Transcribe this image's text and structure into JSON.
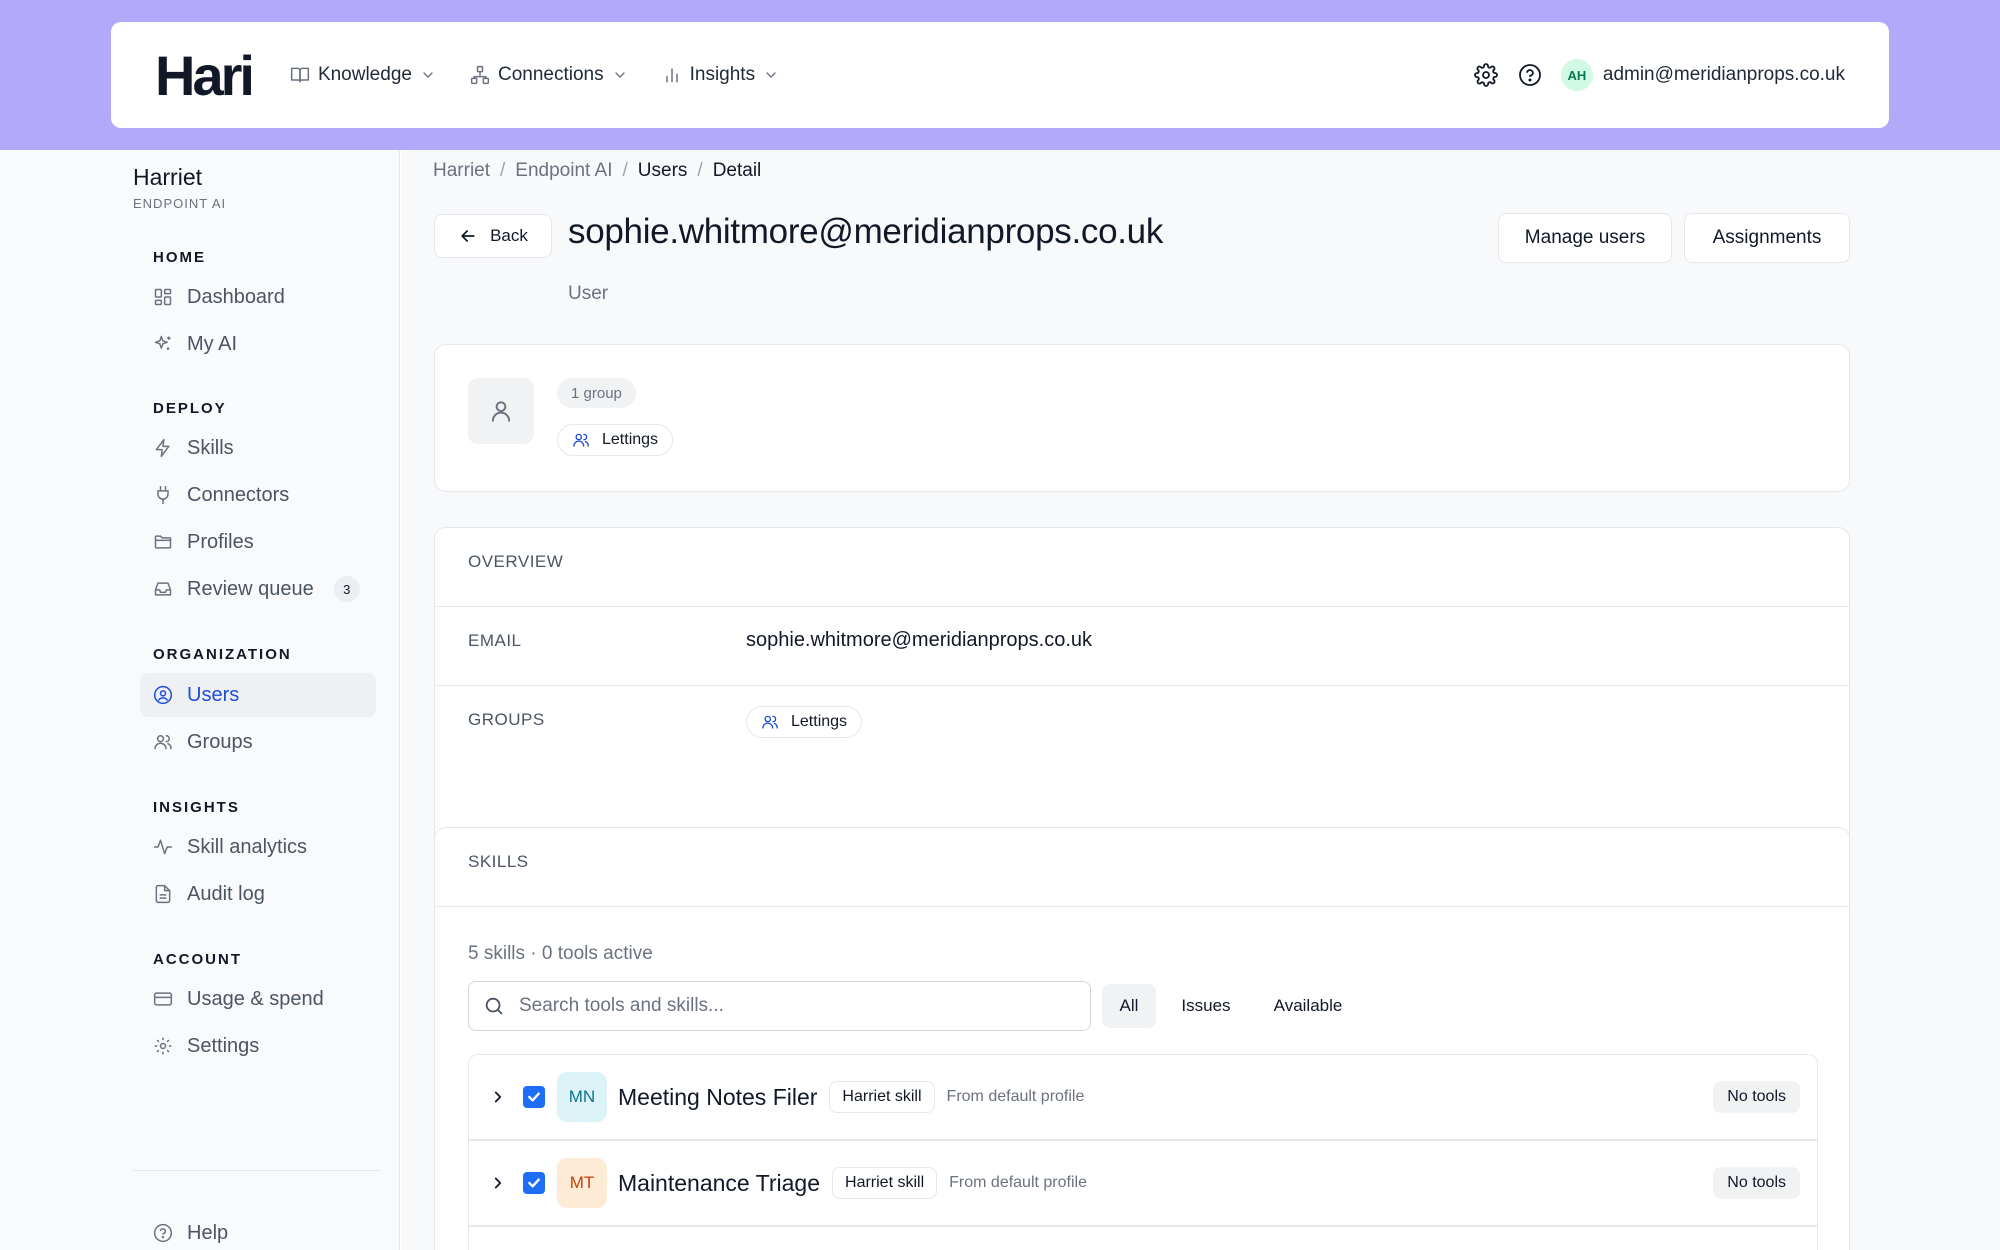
{
  "app": {
    "logo": "Hari"
  },
  "topnav": {
    "items": [
      {
        "label": "Knowledge",
        "icon": "book-icon"
      },
      {
        "label": "Connections",
        "icon": "network-icon"
      },
      {
        "label": "Insights",
        "icon": "bar-chart-icon"
      }
    ],
    "avatar_initials": "AH",
    "user_email": "admin@meridianprops.co.uk",
    "accent_color": "#b3a9fb"
  },
  "sidebar": {
    "org_name": "Harriet",
    "org_sub": "ENDPOINT AI",
    "sections": {
      "home": "HOME",
      "deploy": "DEPLOY",
      "organization": "ORGANIZATION",
      "insights": "INSIGHTS",
      "account": "ACCOUNT"
    },
    "items": {
      "dashboard": "Dashboard",
      "my_ai": "My AI",
      "skills": "Skills",
      "connectors": "Connectors",
      "profiles": "Profiles",
      "review_queue": "Review queue",
      "review_queue_count": "3",
      "users": "Users",
      "groups": "Groups",
      "skill_analytics": "Skill analytics",
      "audit_log": "Audit log",
      "usage_spend": "Usage & spend",
      "settings": "Settings",
      "help": "Help"
    },
    "active_item": "Users"
  },
  "breadcrumb": [
    "Harriet",
    "Endpoint AI",
    "Users",
    "Detail"
  ],
  "header": {
    "back_label": "Back",
    "title": "sophie.whitmore@meridianprops.co.uk",
    "subtitle": "User",
    "manage_users_label": "Manage users",
    "assignments_label": "Assignments"
  },
  "profile_card": {
    "group_count": "1 group",
    "group_chip": "Lettings"
  },
  "overview": {
    "title": "OVERVIEW",
    "email_label": "EMAIL",
    "email_value": "sophie.whitmore@meridianprops.co.uk",
    "groups_label": "GROUPS",
    "groups_value": "Lettings"
  },
  "skills": {
    "title": "SKILLS",
    "summary": "5 skills · 0 tools active",
    "search_placeholder": "Search tools and skills...",
    "filters": [
      "All",
      "Issues",
      "Available"
    ],
    "active_filter": "All",
    "rows": [
      {
        "initials": "MN",
        "name": "Meeting Notes Filer",
        "tag": "Harriet skill",
        "source": "From default profile",
        "tools": "No tools",
        "checked": true,
        "color_bg": "#dcf3f8",
        "color_fg": "#0e7490"
      },
      {
        "initials": "MT",
        "name": "Maintenance Triage",
        "tag": "Harriet skill",
        "source": "From default profile",
        "tools": "No tools",
        "checked": true,
        "color_bg": "#fdebd6",
        "color_fg": "#c2410c"
      }
    ]
  }
}
